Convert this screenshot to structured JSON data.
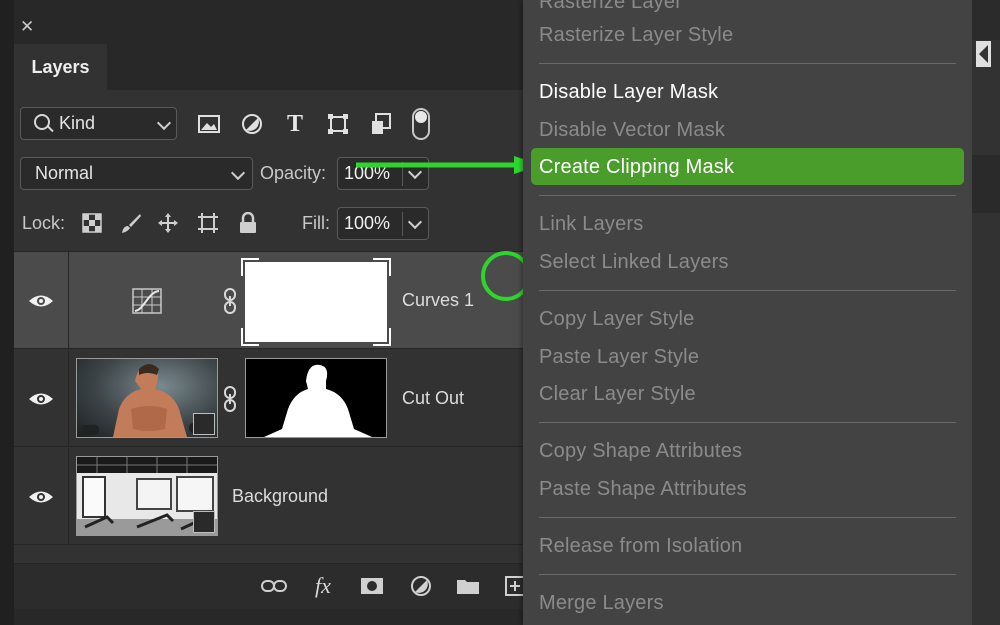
{
  "panel": {
    "close_glyph": "✕",
    "tab": "Layers",
    "filter": {
      "kind_label": "Kind",
      "icons": [
        "image-filter-icon",
        "adjustment-filter-icon",
        "type-filter-icon",
        "shape-filter-icon",
        "smart-object-filter-icon"
      ],
      "type_glyph": "T"
    },
    "blend_mode": "Normal",
    "opacity": {
      "label": "Opacity:",
      "value": "100%"
    },
    "lock": {
      "label": "Lock:",
      "icons": [
        "lock-transparent-icon",
        "lock-image-icon",
        "lock-position-icon",
        "lock-artboard-icon",
        "lock-all-icon"
      ]
    },
    "fill": {
      "label": "Fill:",
      "value": "100%"
    },
    "layers": [
      {
        "name": "Curves 1",
        "type": "adjustment",
        "selected": true
      },
      {
        "name": "Cut Out",
        "type": "smart-object-with-mask",
        "selected": false
      },
      {
        "name": "Background",
        "type": "smart-object",
        "selected": false
      }
    ],
    "bottom_icons": [
      "link-layers-icon",
      "fx-icon",
      "add-mask-icon",
      "adjustment-layer-icon",
      "new-group-icon",
      "new-layer-icon"
    ],
    "fx_glyph": "fx"
  },
  "menu": {
    "items": [
      {
        "label": "Rasterize Layer",
        "enabled": false
      },
      {
        "label": "Rasterize Layer Style",
        "enabled": false
      },
      {
        "label": "Disable Layer Mask",
        "enabled": true
      },
      {
        "label": "Disable Vector Mask",
        "enabled": false
      },
      {
        "label": "Create Clipping Mask",
        "enabled": true,
        "highlighted": true
      },
      {
        "label": "Link Layers",
        "enabled": false
      },
      {
        "label": "Select Linked Layers",
        "enabled": false
      },
      {
        "label": "Copy Layer Style",
        "enabled": false
      },
      {
        "label": "Paste Layer Style",
        "enabled": false
      },
      {
        "label": "Clear Layer Style",
        "enabled": false
      },
      {
        "label": "Copy Shape Attributes",
        "enabled": false
      },
      {
        "label": "Paste Shape Attributes",
        "enabled": false
      },
      {
        "label": "Release from Isolation",
        "enabled": false
      },
      {
        "label": "Merge Layers",
        "enabled": false
      }
    ]
  },
  "colors": {
    "panel_bg": "#323232",
    "menu_bg": "#434343",
    "highlight": "#4a9d2a",
    "annotation": "#2fd52f"
  }
}
